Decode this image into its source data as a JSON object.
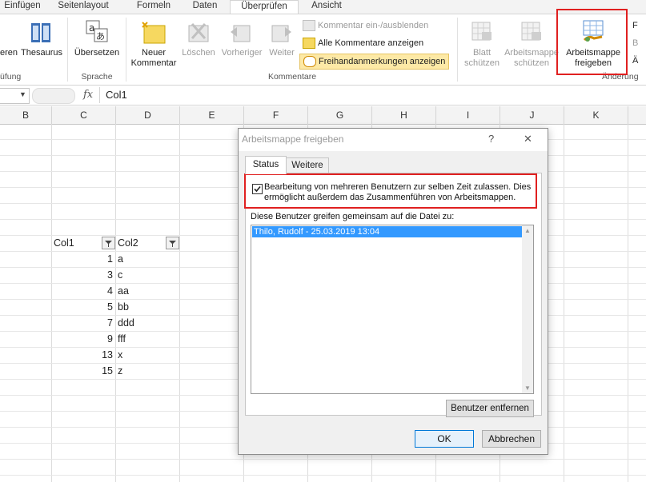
{
  "tabs": [
    "Einfügen",
    "Seitenlayout",
    "Formeln",
    "Daten",
    "Überprüfen",
    "Ansicht"
  ],
  "ribbon": {
    "thesaurus_cut": "eren",
    "thesaurus": "Thesaurus",
    "group_pruefung_cut": "üfung",
    "uebersetzen": "Übersetzen",
    "group_sprache": "Sprache",
    "neuer_kommentar_l1": "Neuer",
    "neuer_kommentar_l2": "Kommentar",
    "loeschen": "Löschen",
    "vorheriger": "Vorheriger",
    "weiter": "Weiter",
    "kommentar_ein": "Kommentar ein-/ausblenden",
    "alle_kommentare": "Alle Kommentare anzeigen",
    "freihand": "Freihandanmerkungen anzeigen",
    "group_kommentare": "Kommentare",
    "blatt_l1": "Blatt",
    "blatt_l2": "schützen",
    "mappe_l1": "Arbeitsmappe",
    "mappe_l2": "schützen",
    "freigeben_l1": "Arbeitsmappe",
    "freigeben_l2": "freigeben",
    "group_aenderungen_cut": "Änderung",
    "right_cut_1": "F",
    "right_cut_2": "B",
    "right_cut_3": "Ä"
  },
  "formula": {
    "fx": "fx",
    "content": "Col1"
  },
  "columns": [
    "B",
    "C",
    "D",
    "E",
    "F",
    "G",
    "H",
    "I",
    "J",
    "K"
  ],
  "table": {
    "header": [
      "Col1",
      "Col2"
    ],
    "rows": [
      [
        "1",
        "a"
      ],
      [
        "3",
        "c"
      ],
      [
        "4",
        "aa"
      ],
      [
        "5",
        "bb"
      ],
      [
        "7",
        "ddd"
      ],
      [
        "9",
        "fff"
      ],
      [
        "13",
        "x"
      ],
      [
        "15",
        "z"
      ]
    ]
  },
  "dialog": {
    "title": "Arbeitsmappe freigeben",
    "help": "?",
    "close": "✕",
    "tab_status": "Status",
    "tab_weitere": "Weitere",
    "checkbox_line1": "Bearbeitung von mehreren Benutzern zur selben Zeit zulassen. Dies",
    "checkbox_line2": "ermöglicht außerdem das Zusammenführen von Arbeitsmappen.",
    "users_label": "Diese Benutzer greifen gemeinsam auf die Datei zu:",
    "users": [
      "Thilo, Rudolf - 25.03.2019 13:04"
    ],
    "remove_button": "Benutzer entfernen",
    "ok": "OK",
    "cancel": "Abbrechen"
  },
  "colors": {
    "accent": "#2b579a",
    "highlight_red": "#e02020",
    "selection_blue": "#3399ff"
  }
}
